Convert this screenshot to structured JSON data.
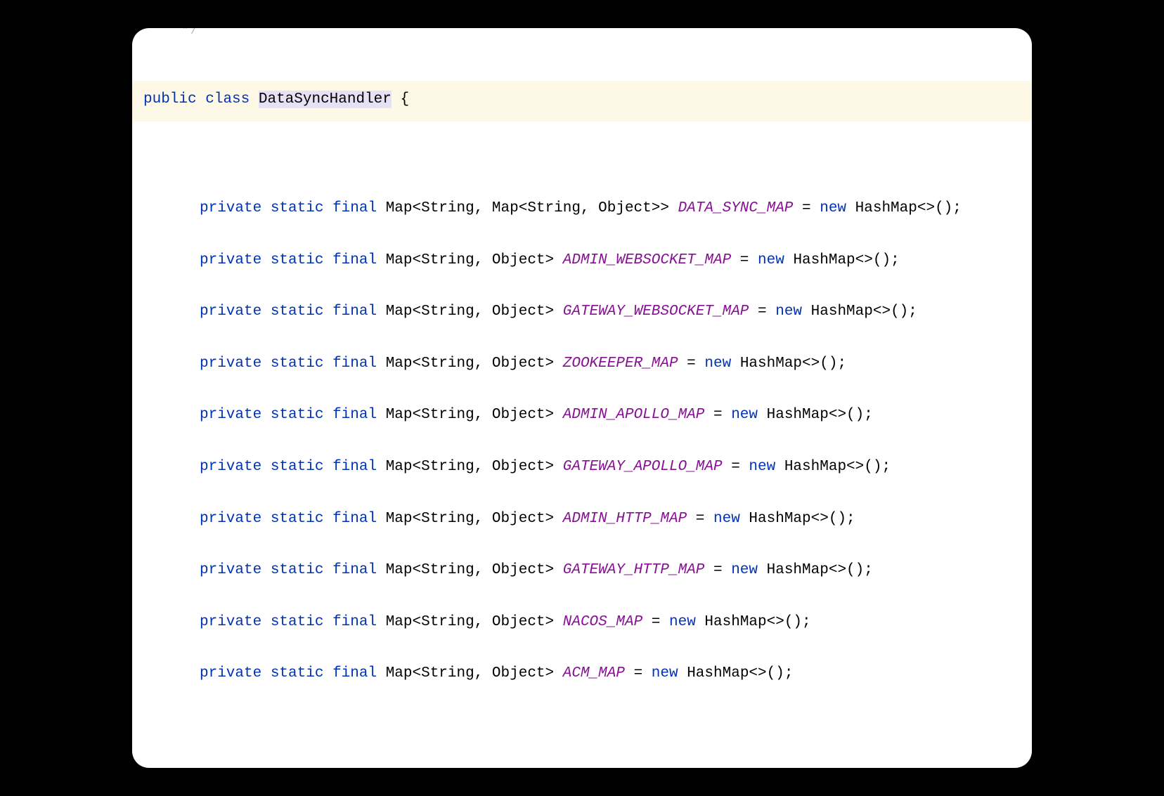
{
  "decl": {
    "public": "public",
    "class": "class",
    "name": "DataSyncHandler",
    "brace": "{"
  },
  "kw": {
    "private": "private",
    "static": "static",
    "final": "final",
    "new": "new"
  },
  "types": {
    "Map": "Map",
    "String": "String",
    "Object": "Object",
    "HashMap": "HashMap"
  },
  "fields": [
    {
      "generic": "<String, Map<String, Object>>",
      "name": "DATA_SYNC_MAP"
    },
    {
      "generic": "<String, Object>",
      "name": "ADMIN_WEBSOCKET_MAP"
    },
    {
      "generic": "<String, Object>",
      "name": "GATEWAY_WEBSOCKET_MAP"
    },
    {
      "generic": "<String, Object>",
      "name": "ZOOKEEPER_MAP"
    },
    {
      "generic": "<String, Object>",
      "name": "ADMIN_APOLLO_MAP"
    },
    {
      "generic": "<String, Object>",
      "name": "GATEWAY_APOLLO_MAP"
    },
    {
      "generic": "<String, Object>",
      "name": "ADMIN_HTTP_MAP"
    },
    {
      "generic": "<String, Object>",
      "name": "GATEWAY_HTTP_MAP"
    },
    {
      "generic": "<String, Object>",
      "name": "NACOS_MAP"
    },
    {
      "generic": "<String, Object>",
      "name": "ACM_MAP"
    }
  ],
  "tail": {
    "eq": " = ",
    "diamond": "<>();"
  }
}
